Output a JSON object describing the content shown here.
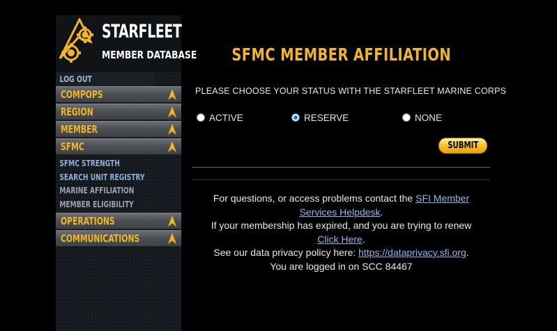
{
  "sidebar": {
    "logo_title": "STARFLEET",
    "logo_subtitle": "MEMBER DATABASE",
    "logout": "LOG OUT",
    "menu": [
      {
        "label": "COMPOPS"
      },
      {
        "label": "REGION"
      },
      {
        "label": "MEMBER"
      },
      {
        "label": "SFMC"
      }
    ],
    "sfmc_submenu": [
      {
        "label": "SFMC STRENGTH",
        "state": "link"
      },
      {
        "label": "SEARCH UNIT REGISTRY",
        "state": "link"
      },
      {
        "label": "MARINE AFFILIATION",
        "state": "current"
      },
      {
        "label": "MEMBER ELIGIBILITY",
        "state": "current"
      }
    ],
    "menu_lower": [
      {
        "label": "OPERATIONS"
      },
      {
        "label": "COMMUNICATIONS"
      }
    ]
  },
  "main": {
    "title": "SFMC MEMBER AFFILIATION",
    "question": "PLEASE CHOOSE YOUR STATUS WITH THE STARFLEET MARINE CORPS",
    "options": [
      {
        "label": "ACTIVE",
        "selected": false
      },
      {
        "label": "RESERVE",
        "selected": true
      },
      {
        "label": "NONE",
        "selected": false
      }
    ],
    "submit_label": "SUBMIT"
  },
  "footer": {
    "contact_text": "For questions, or access problems contact the",
    "helpdesk_link_1": "SFI Member",
    "helpdesk_link_2": "Services Helpdesk",
    "period": ".",
    "renew_text": "If your membership has expired, and you are trying to renew",
    "click_here": "Click Here",
    "privacy_text": "See our data privacy policy here:",
    "privacy_link": "https://dataprivacy.sfi.org",
    "logged_in": "You are logged in on SCC 84467"
  },
  "colors": {
    "accent_gold": "#f2b625",
    "link_blue": "#8fb8ec",
    "radio_blue": "#1a73e8"
  },
  "icons": {
    "logo": "gears-emblem-icon",
    "menu_arrow": "starfleet-delta-icon"
  }
}
